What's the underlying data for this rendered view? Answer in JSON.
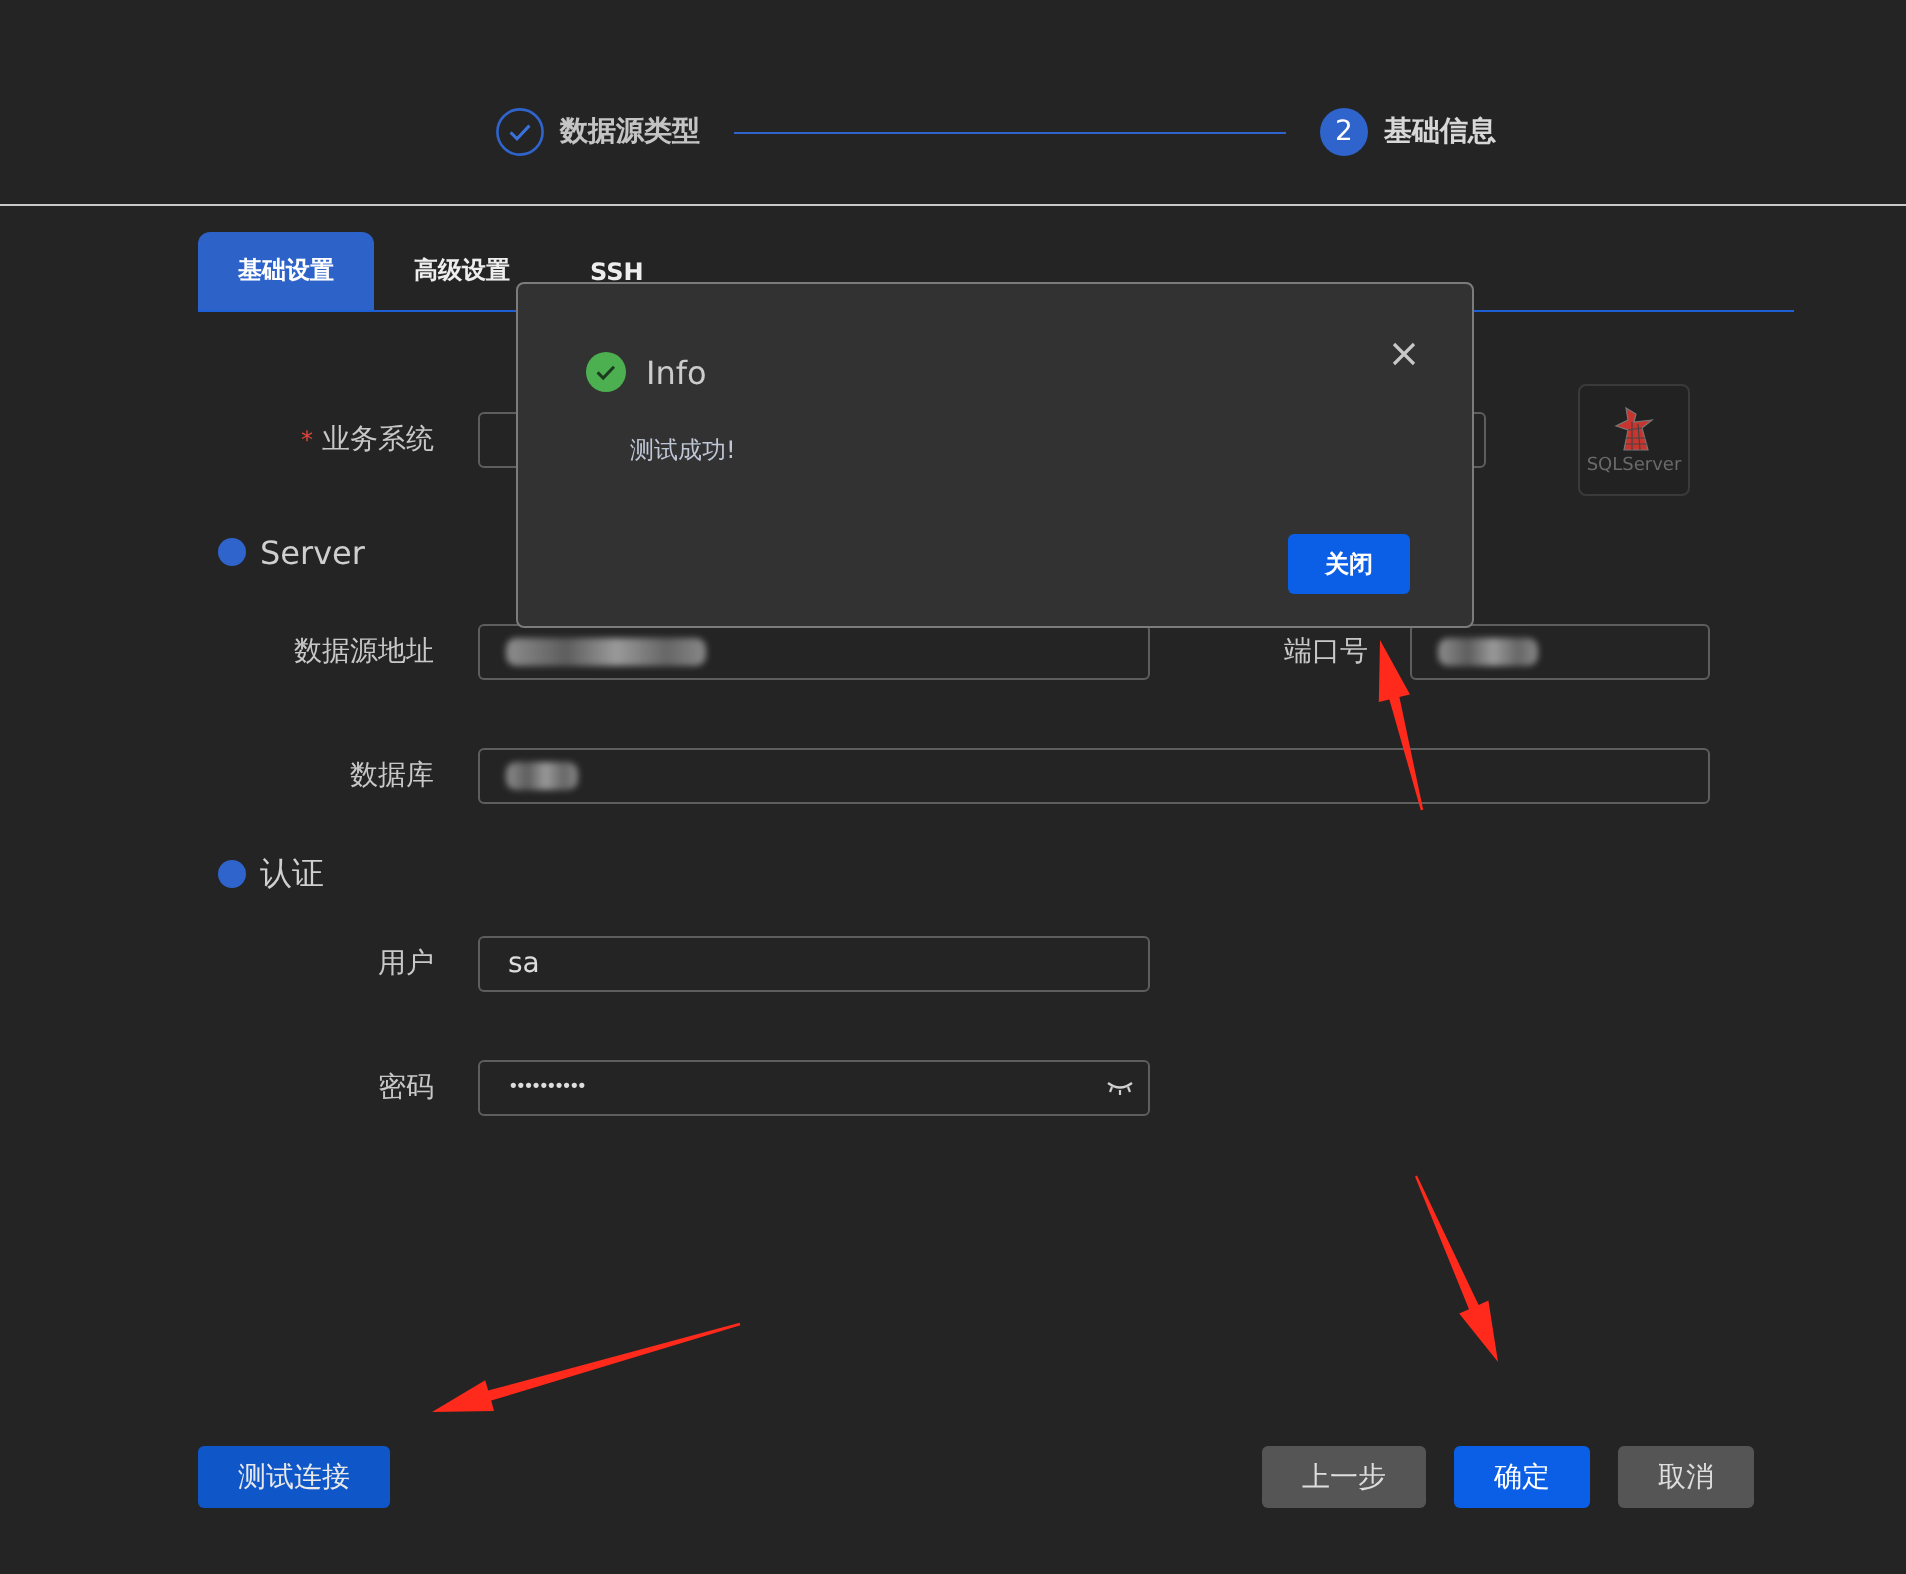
{
  "stepper": {
    "steps": [
      {
        "kind": "done",
        "label": "数据源类型"
      },
      {
        "kind": "current",
        "number": "2",
        "label": "基础信息"
      }
    ]
  },
  "tabs": [
    {
      "label": "基础设置",
      "selected": true
    },
    {
      "label": "高级设置",
      "selected": false
    },
    {
      "label": "SSH",
      "selected": false
    }
  ],
  "business_system": {
    "required_mark": "*",
    "label": "业务系统",
    "logo_text": "SQLServer"
  },
  "sections": [
    {
      "title": "Server",
      "rows": [
        [
          {
            "kind": "text",
            "label": "数据源地址",
            "redacted": true
          },
          {
            "kind": "text",
            "label": "端口号",
            "redacted": true
          }
        ],
        [
          {
            "kind": "text",
            "label": "数据库",
            "redacted": true
          }
        ]
      ]
    },
    {
      "title": "认证",
      "rows": [
        [
          {
            "kind": "text",
            "label": "用户",
            "value": "sa"
          }
        ],
        [
          {
            "kind": "password",
            "label": "密码",
            "value": "••••••••••"
          }
        ]
      ]
    }
  ],
  "footer": {
    "left": [
      {
        "label": "测试连接",
        "kind": "info"
      }
    ],
    "right": [
      {
        "label": "上一步",
        "kind": "secondary"
      },
      {
        "label": "确定",
        "kind": "primary"
      },
      {
        "label": "取消",
        "kind": "secondary"
      }
    ]
  },
  "dialog": {
    "kind": "success",
    "title": "Info",
    "message": "测试成功!",
    "button": "关闭"
  },
  "annotations": [
    {
      "kind": "arrow"
    },
    {
      "kind": "arrow"
    },
    {
      "kind": "arrow"
    }
  ]
}
